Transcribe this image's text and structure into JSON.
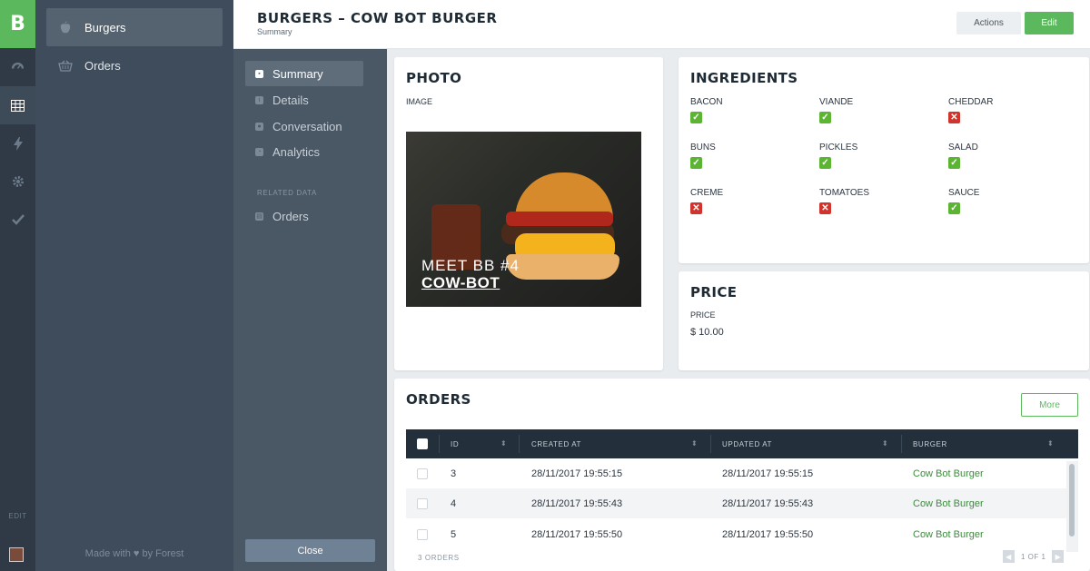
{
  "brand": {
    "logo_letter": "B"
  },
  "rail": {
    "edit_label": "EDIT"
  },
  "collections": {
    "items": [
      {
        "label": "Burgers",
        "icon": "apple-icon",
        "active": true
      },
      {
        "label": "Orders",
        "icon": "basket-icon",
        "active": false
      }
    ],
    "footer": {
      "made_with": "Made with",
      "by": "by Forest"
    }
  },
  "header": {
    "title": "BURGERS – COW BOT BURGER",
    "subtitle": "Summary",
    "actions_label": "Actions",
    "edit_label": "Edit"
  },
  "record_nav": {
    "items": [
      {
        "label": "Summary",
        "active": true
      },
      {
        "label": "Details",
        "active": false
      },
      {
        "label": "Conversation",
        "active": false
      },
      {
        "label": "Analytics",
        "active": false
      }
    ],
    "related_heading": "RELATED DATA",
    "related_items": [
      {
        "label": "Orders"
      }
    ],
    "close_label": "Close"
  },
  "photo_card": {
    "title": "PHOTO",
    "field_label": "IMAGE",
    "image_text_line1": "MEET BB #4",
    "image_text_line2": "COW-BOT"
  },
  "ingredients_card": {
    "title": "INGREDIENTS",
    "items": [
      {
        "name": "BACON",
        "checked": true
      },
      {
        "name": "VIANDE",
        "checked": true
      },
      {
        "name": "CHEDDAR",
        "checked": false
      },
      {
        "name": "BUNS",
        "checked": true
      },
      {
        "name": "PICKLES",
        "checked": true
      },
      {
        "name": "SALAD",
        "checked": true
      },
      {
        "name": "CREME",
        "checked": false
      },
      {
        "name": "TOMATOES",
        "checked": false
      },
      {
        "name": "SAUCE",
        "checked": true
      }
    ]
  },
  "price_card": {
    "title": "PRICE",
    "field_label": "PRICE",
    "value": "$ 10.00"
  },
  "orders_card": {
    "title": "ORDERS",
    "more_label": "More",
    "columns": [
      "ID",
      "CREATED AT",
      "UPDATED AT",
      "BURGER"
    ],
    "rows": [
      {
        "id": "3",
        "created_at": "28/11/2017 19:55:15",
        "updated_at": "28/11/2017 19:55:15",
        "burger": "Cow Bot Burger"
      },
      {
        "id": "4",
        "created_at": "28/11/2017 19:55:43",
        "updated_at": "28/11/2017 19:55:43",
        "burger": "Cow Bot Burger"
      },
      {
        "id": "5",
        "created_at": "28/11/2017 19:55:50",
        "updated_at": "28/11/2017 19:55:50",
        "burger": "Cow Bot Burger"
      }
    ],
    "count_label": "3 ORDERS",
    "pagination": "1 OF 1"
  },
  "colors": {
    "accent": "#5cb85c",
    "check_yes": "#5bb532",
    "check_no": "#d0342c",
    "sidebar": "#3e4c5b",
    "table_header": "#23303c"
  }
}
